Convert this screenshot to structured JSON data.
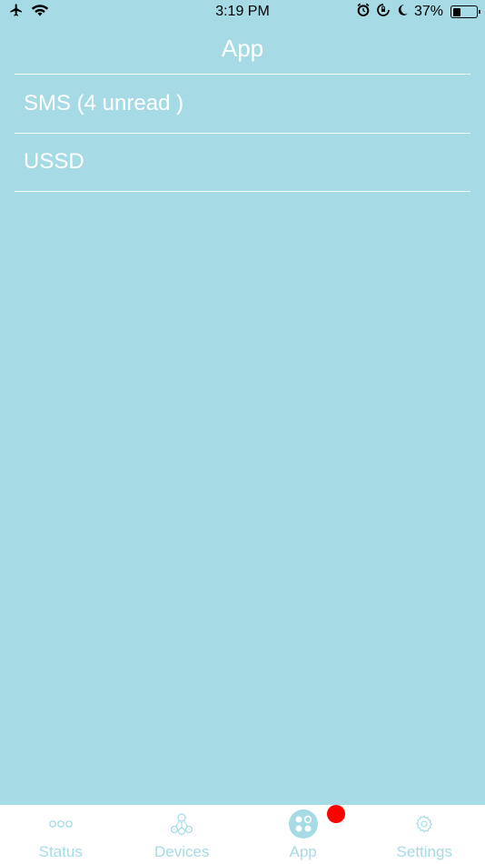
{
  "status_bar": {
    "time": "3:19 PM",
    "battery_percent": "37%",
    "battery_level": 0.37,
    "icons_left": [
      "airplane-icon",
      "wifi-icon"
    ],
    "icons_right": [
      "alarm-icon",
      "rotation-lock-icon",
      "moon-icon",
      "battery-icon"
    ]
  },
  "header": {
    "title": "App"
  },
  "list": {
    "items": [
      {
        "label": "SMS (4 unread )"
      },
      {
        "label": "USSD"
      }
    ]
  },
  "tab_bar": {
    "tabs": [
      {
        "label": "Status",
        "icon": "dots-icon",
        "active": false
      },
      {
        "label": "Devices",
        "icon": "devices-icon",
        "active": false
      },
      {
        "label": "App",
        "icon": "app-grid-icon",
        "active": true,
        "badge": true
      },
      {
        "label": "Settings",
        "icon": "gear-icon",
        "active": false
      }
    ]
  },
  "colors": {
    "background": "#a6dbe6",
    "accent": "#a6dbe6",
    "badge": "#ff0000",
    "tab_bar_bg": "#ffffff"
  }
}
